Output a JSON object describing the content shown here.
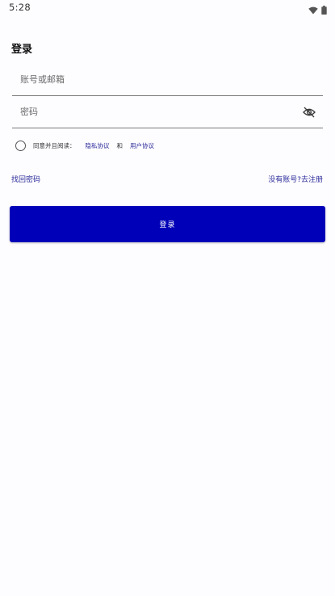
{
  "status_bar": {
    "time": "5:28",
    "icons": [
      "wifi-icon",
      "battery-icon"
    ]
  },
  "login": {
    "title": "登录",
    "account_placeholder": "账号或邮箱",
    "account_value": "",
    "password_placeholder": "密码",
    "password_value": "",
    "password_toggle_icon": "eye-off-icon",
    "agreement": {
      "prefix": "同意并且阅读：",
      "privacy_link": "隐私协议",
      "and": "和",
      "user_link": "用户协议"
    },
    "forgot_password": "找回密码",
    "register": "没有账号?去注册",
    "submit_label": "登录"
  },
  "colors": {
    "accent": "#0000b8",
    "link": "#2b2b9a",
    "background": "#fdfcff"
  }
}
